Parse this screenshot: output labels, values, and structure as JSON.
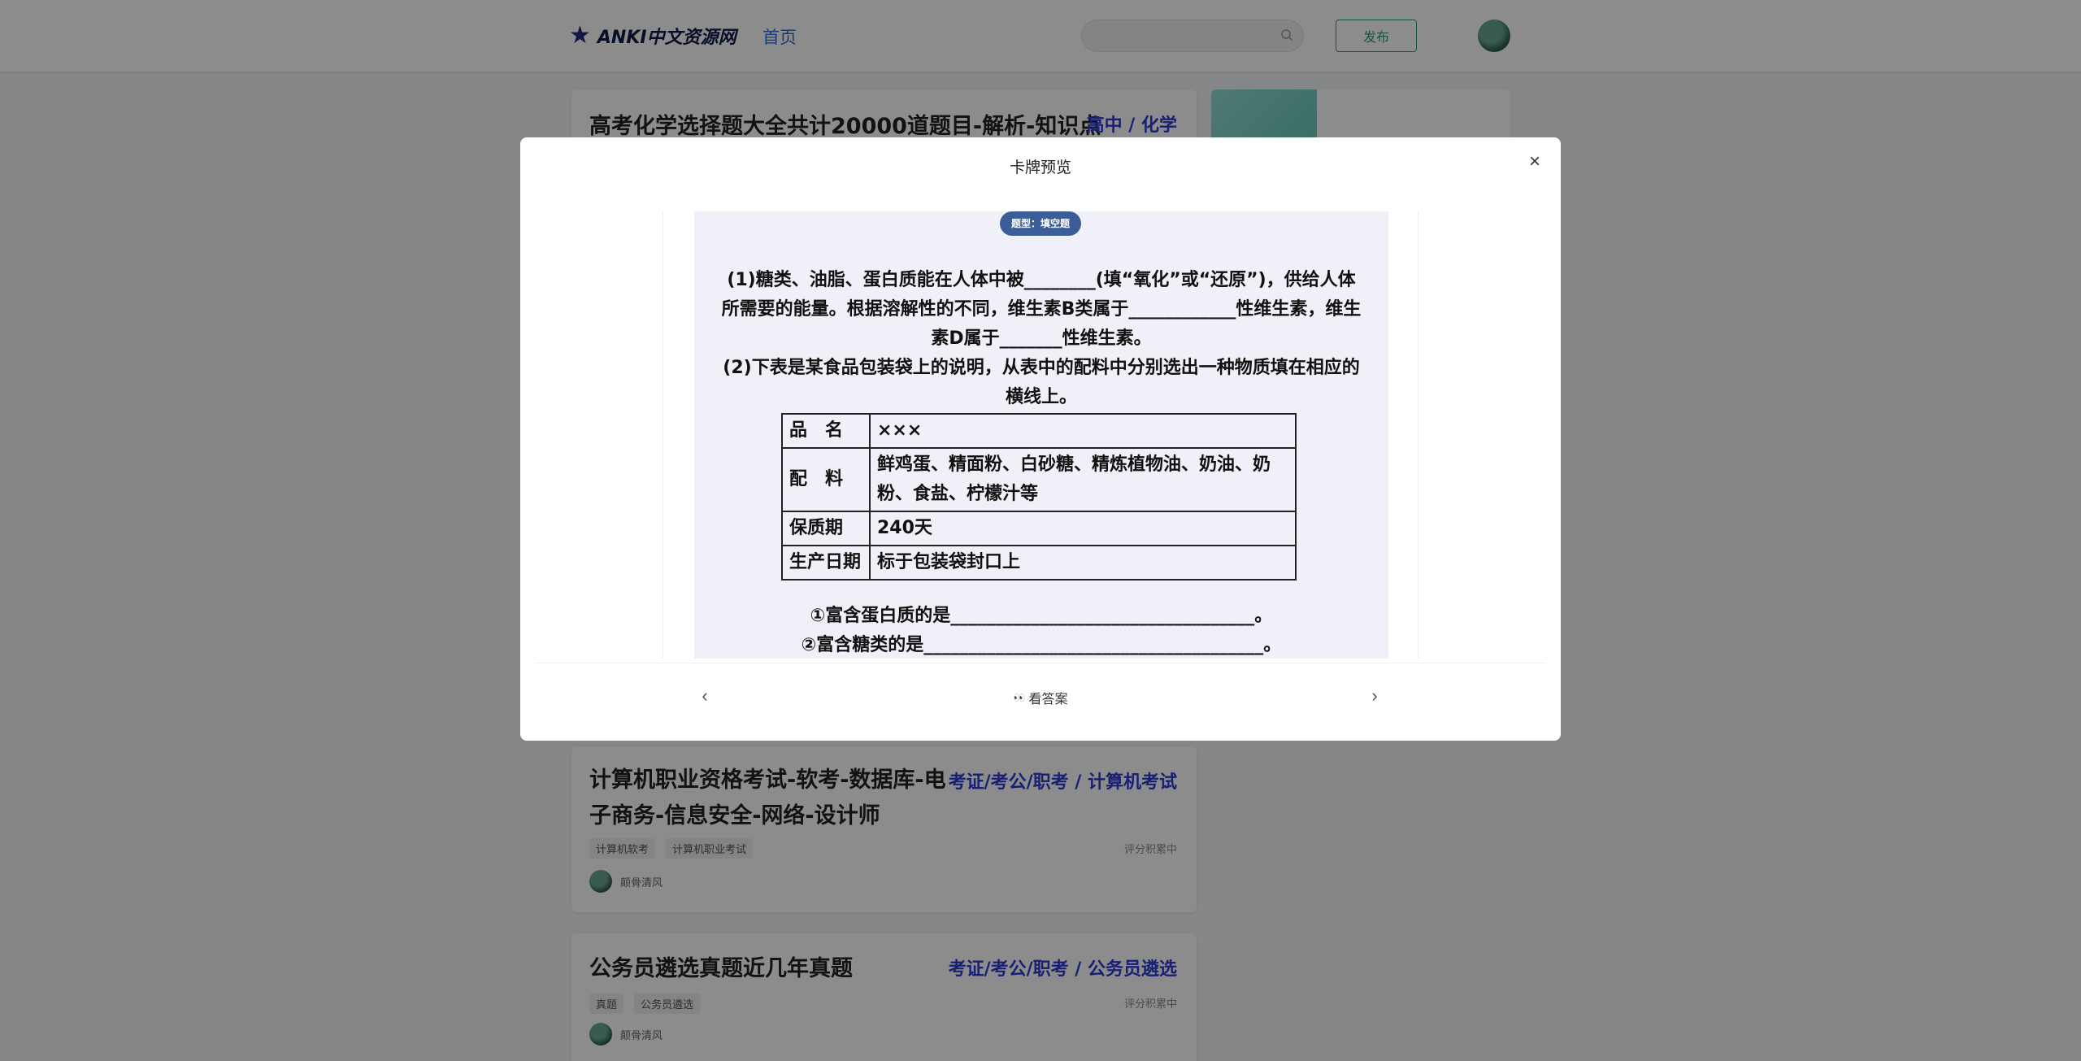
{
  "header": {
    "logo_text": "ANKI中文资源网",
    "nav_home": "首页",
    "search_placeholder": "",
    "publish_label": "发布"
  },
  "cards": [
    {
      "title": "高考化学选择题大全共计20000道题目-解析-知识点",
      "category": "高中 / 化学"
    },
    {
      "title_line1": "计算机职业资格考试-软考-数据库-电",
      "title_line2": "子商务-信息安全-网络-设计师",
      "category": "考证/考公/职考 / 计算机考试",
      "tags": [
        "计算机软考",
        "计算机职业考试"
      ],
      "rating": "评分积累中",
      "author": "颠骨清风"
    },
    {
      "title": "公务员遴选真题近几年真题",
      "category": "考证/考公/职考 / 公务员遴选",
      "tags": [
        "真题",
        "公务员遴选"
      ],
      "rating": "评分积累中",
      "author": "颠骨清风"
    }
  ],
  "modal": {
    "title": "卡牌预览",
    "close_label": "×",
    "type_badge": "题型：填空题",
    "question_p1": "(1)糖类、油脂、蛋白质能在人体中被________(填“氧化”或“还原”)，供给人体所需要的能量。根据溶解性的不同，维生素B类属于____________性维生素，维生素D属于_______性维生素。",
    "question_p2": "(2)下表是某食品包装袋上的说明，从表中的配料中分别选出一种物质填在相应的横线上。",
    "table": [
      {
        "k": "品　名",
        "v": "×××"
      },
      {
        "k": "配　料",
        "v": "鲜鸡蛋、精面粉、白砂糖、精炼植物油、奶油、奶粉、食盐、柠檬汁等"
      },
      {
        "k": "保质期",
        "v": "240天"
      },
      {
        "k": "生产日期",
        "v": "标于包装袋封口上"
      }
    ],
    "sub1": "①富含蛋白质的是__________________________________。",
    "sub2": "②富含糖类的是______________________________________。",
    "prev_label": "‹",
    "next_label": "›",
    "answer_icon": "👀",
    "answer_label": "看答案"
  }
}
